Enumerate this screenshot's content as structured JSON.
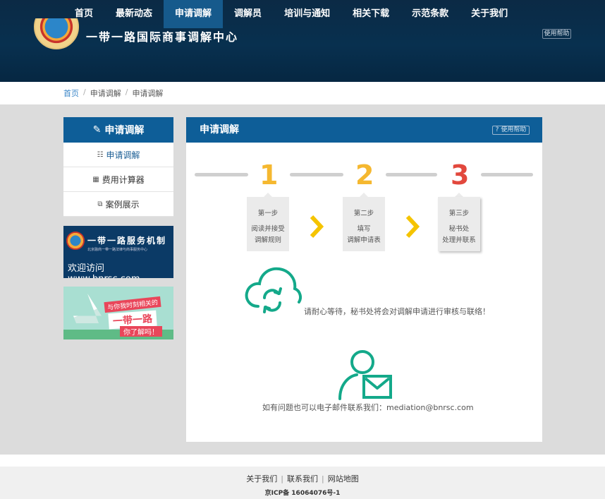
{
  "nav": {
    "items": [
      "首页",
      "最新动态",
      "申请调解",
      "调解员",
      "培训与通知",
      "相关下载",
      "示范条款",
      "关于我们"
    ]
  },
  "header": {
    "site_title": "一带一路国际商事调解中心",
    "help_label": "使用帮助"
  },
  "breadcrumb": {
    "home": "首页",
    "parent": "申请调解",
    "current": "申请调解",
    "separator": "/"
  },
  "sidebar": {
    "title": "申请调解",
    "items": [
      {
        "label": "申请调解",
        "icon": "form-icon"
      },
      {
        "label": "费用计算器",
        "icon": "calculator-icon"
      },
      {
        "label": "案例展示",
        "icon": "copy-icon"
      }
    ],
    "banner1": {
      "title": "一带一路服务机制",
      "subtitle": "北京融商一带一路法律与商事服务中心",
      "line": "欢迎访问 www.bnrsc.com"
    },
    "banner2": {
      "line1": "与你我时刻相关的",
      "line2": "一带一路",
      "line3": "你了解吗！"
    }
  },
  "panel": {
    "title": "申请调解",
    "help_label": "使用帮助",
    "steps": [
      {
        "number": "1",
        "label": "第一步",
        "line1": "阅读并接受",
        "line2": "调解规则",
        "color": "#f5b830"
      },
      {
        "number": "2",
        "label": "第二步",
        "line1": "填写",
        "line2": "调解申请表",
        "color": "#f5b830"
      },
      {
        "number": "3",
        "label": "第三步",
        "line1": "秘书处",
        "line2": "处理并联系",
        "color": "#e2483d"
      }
    ],
    "wait_message": "请耐心等待，秘书处将会对调解申请进行审核与联络！",
    "contact_message": "如有问题也可以电子邮件联系我们：mediation@bnrsc.com",
    "accent": "#14a98a"
  },
  "footer": {
    "links": [
      "关于我们",
      "联系我们",
      "网站地图"
    ],
    "icp": "京ICP备 16064076号-1"
  }
}
